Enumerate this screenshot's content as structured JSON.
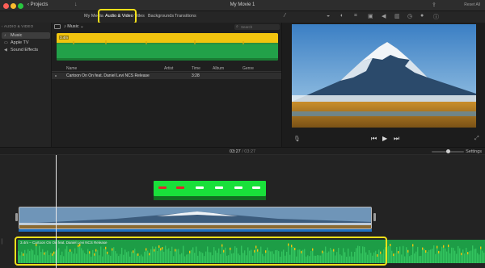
{
  "window": {
    "title": "My Movie 1",
    "projects_label": "Projects",
    "reset_all_label": "Reset All"
  },
  "tabs": [
    {
      "label": "My Media",
      "active": false
    },
    {
      "label": "Audio & Video",
      "active": true
    },
    {
      "label": "Titles",
      "active": false
    },
    {
      "label": "Backgrounds",
      "active": false
    },
    {
      "label": "Transitions",
      "active": false
    }
  ],
  "sidebar": {
    "heading": "AUDIO & VIDEO",
    "items": [
      {
        "label": "Music",
        "selected": true
      },
      {
        "label": "Apple TV",
        "selected": false
      },
      {
        "label": "Sound Effects",
        "selected": false
      }
    ]
  },
  "browser": {
    "source_select": "Music",
    "search_placeholder": "Search",
    "preview_duration": "3.4m",
    "columns": [
      "Name",
      "Artist",
      "Time",
      "Album",
      "Genre"
    ],
    "rows": [
      {
        "name": "Cartoon On On feat. Daniel Levi NCS Release",
        "artist": "",
        "time": "3:28",
        "album": "",
        "genre": ""
      }
    ]
  },
  "timeline": {
    "current_time": "03:27",
    "separator": "/",
    "total_time": "03:27",
    "settings_label": "Settings",
    "music_clip_label": "3.4m – Cartoon On On feat. Daniel Levi NCS Release",
    "zoom_level": 0.5
  },
  "colors": {
    "highlight": "#f5e21a",
    "waveform_green": "#1d9d46",
    "waveform_peak": "#f1c40f",
    "title_clip": "#19e03a",
    "audio_strip": "#1f72c6"
  },
  "icons": [
    "back-chevron-icon",
    "import-icon",
    "check-icon",
    "share-icon",
    "magic-wand-icon",
    "color-balance-icon",
    "crop-icon",
    "stabilization-icon",
    "volume-icon",
    "noise-reduction-icon",
    "speed-icon",
    "filter-icon",
    "info-icon",
    "search-icon",
    "microphone-icon",
    "skip-back-icon",
    "play-icon",
    "skip-forward-icon",
    "fullscreen-icon",
    "music-note-icon",
    "tv-icon",
    "speaker-icon"
  ]
}
